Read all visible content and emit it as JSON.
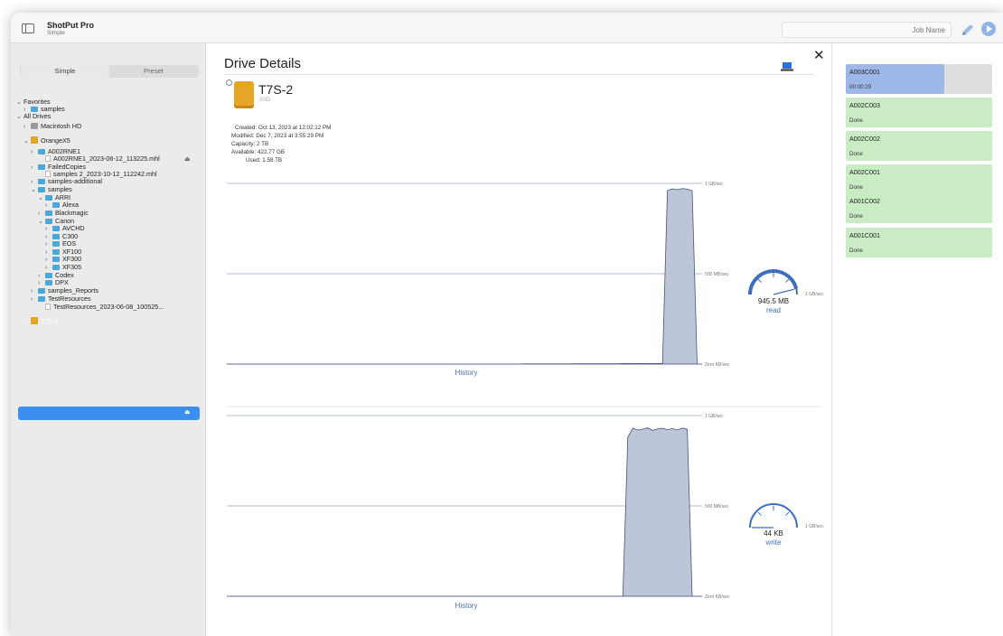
{
  "app": {
    "title": "ShotPut Pro",
    "mode": "Simple",
    "job_name_placeholder": "Job Name"
  },
  "sidebar": {
    "segments": [
      "Simple",
      "Preset"
    ],
    "tree": [
      {
        "label": "Favorites",
        "level": 0,
        "type": "section",
        "chev": "v"
      },
      {
        "label": "samples",
        "level": 1,
        "type": "folder",
        "chev": ">"
      },
      {
        "label": "All Drives",
        "level": 0,
        "type": "section",
        "chev": "v"
      },
      {
        "label": "Macintosh HD",
        "level": 1,
        "type": "hd",
        "chev": ">"
      },
      {
        "label": "OrangeX5",
        "level": 1,
        "type": "drive",
        "chev": "v"
      },
      {
        "label": "A002RNE1",
        "level": 2,
        "type": "folder",
        "chev": ">"
      },
      {
        "label": "A002RNE1_2023-06-12_113225.mhl",
        "level": 3,
        "type": "file",
        "chev": ""
      },
      {
        "label": "FailedCopies",
        "level": 2,
        "type": "folder",
        "chev": ">"
      },
      {
        "label": "samples 2_2023-10-12_112242.mhl",
        "level": 3,
        "type": "file",
        "chev": ""
      },
      {
        "label": "samples-additional",
        "level": 2,
        "type": "folder",
        "chev": ">"
      },
      {
        "label": "samples",
        "level": 2,
        "type": "folder",
        "chev": "v"
      },
      {
        "label": "ARRI",
        "level": 3,
        "type": "folder",
        "chev": "v"
      },
      {
        "label": "Alexa",
        "level": 4,
        "type": "folder",
        "chev": ">"
      },
      {
        "label": "Blackmagic",
        "level": 3,
        "type": "folder",
        "chev": ">"
      },
      {
        "label": "Canon",
        "level": 3,
        "type": "folder",
        "chev": "v"
      },
      {
        "label": "AVCHD",
        "level": 4,
        "type": "folder",
        "chev": ">"
      },
      {
        "label": "C300",
        "level": 4,
        "type": "folder",
        "chev": ">"
      },
      {
        "label": "EOS",
        "level": 4,
        "type": "folder",
        "chev": ">"
      },
      {
        "label": "XF100",
        "level": 4,
        "type": "folder",
        "chev": ">"
      },
      {
        "label": "XF300",
        "level": 4,
        "type": "folder",
        "chev": ">"
      },
      {
        "label": "XF305",
        "level": 4,
        "type": "folder",
        "chev": ">"
      },
      {
        "label": "Codex",
        "level": 3,
        "type": "folder",
        "chev": ">"
      },
      {
        "label": "DPX",
        "level": 3,
        "type": "folder",
        "chev": ">"
      },
      {
        "label": "samples_Reports",
        "level": 2,
        "type": "folder",
        "chev": ">"
      },
      {
        "label": "TestResources",
        "level": 2,
        "type": "folder",
        "chev": ">"
      },
      {
        "label": "TestResources_2023-06-08_100525...",
        "level": 3,
        "type": "file",
        "chev": ""
      },
      {
        "label": "T7S-2",
        "level": 1,
        "type": "drive",
        "chev": ">",
        "selected": true
      }
    ]
  },
  "main": {
    "heading": "Drive Details",
    "drive": {
      "name": "T7S-2",
      "type": "SSD",
      "created": "Created: Oct 13, 2023 at 12:02:12 PM",
      "modified": "Modified: Dec 7, 2023 at 3:55:29 PM",
      "capacity": "Capacity: 2 TB",
      "available": "Available: 422.77 GB",
      "used": "Used: 1.58 TB"
    },
    "read": {
      "value": "945.5 MB",
      "label": "read",
      "history_label": "History",
      "gauge_fraction": 0.92,
      "axis": [
        "1 GB/sec",
        "500 MB/sec",
        "Zero KB/sec"
      ],
      "gauge_max_label": "1 GB/sec"
    },
    "write": {
      "value": "44 KB",
      "label": "write",
      "history_label": "History",
      "gauge_fraction": 0.0,
      "axis": [
        "1 GB/sec",
        "500 MB/sec",
        "Zero KB/sec"
      ],
      "gauge_max_label": "1 GB/sec"
    }
  },
  "chart_data": [
    {
      "type": "area",
      "title": "",
      "ylabel": "",
      "ylim": [
        0,
        1000
      ],
      "y_unit": "MB/sec",
      "series": [
        {
          "values": [
            0,
            0,
            0,
            0,
            0,
            0,
            0,
            0,
            0,
            0,
            0,
            0,
            0,
            0,
            0,
            0,
            0,
            0,
            0,
            0,
            0,
            0,
            0,
            0,
            0,
            0,
            0,
            0,
            0,
            0,
            0,
            0,
            0,
            0,
            0,
            0,
            0,
            0,
            0,
            0,
            0,
            0,
            0,
            0,
            0,
            0,
            0,
            0,
            0,
            0,
            0,
            0,
            0,
            0,
            0,
            0,
            0,
            0,
            0,
            0,
            1,
            1,
            1,
            1,
            1,
            1,
            1,
            1,
            1,
            1,
            2,
            2,
            2,
            2,
            2,
            2,
            2,
            2,
            2,
            2,
            3,
            3,
            3,
            3,
            3,
            3,
            3,
            3,
            3,
            960,
            970,
            965,
            972,
            968,
            960,
            0,
            0
          ]
        }
      ]
    },
    {
      "type": "area",
      "title": "",
      "ylabel": "",
      "ylim": [
        0,
        1000
      ],
      "y_unit": "MB/sec",
      "series": [
        {
          "values": [
            0,
            0,
            0,
            0,
            0,
            0,
            0,
            0,
            0,
            0,
            0,
            0,
            0,
            0,
            0,
            0,
            0,
            0,
            0,
            0,
            0,
            0,
            0,
            0,
            0,
            0,
            0,
            0,
            0,
            0,
            0,
            0,
            0,
            0,
            0,
            0,
            0,
            0,
            0,
            0,
            0,
            0,
            0,
            0,
            0,
            0,
            0,
            0,
            0,
            0,
            0,
            0,
            0,
            0,
            0,
            0,
            0,
            0,
            0,
            0,
            0,
            0,
            0,
            0,
            0,
            0,
            0,
            0,
            0,
            0,
            0,
            0,
            0,
            0,
            0,
            0,
            0,
            0,
            0,
            0,
            0,
            880,
            930,
            920,
            925,
            932,
            918,
            926,
            930,
            922,
            928,
            920,
            931,
            924,
            0,
            0,
            0
          ]
        }
      ]
    }
  ],
  "jobs": [
    {
      "name": "A003C001",
      "status": "00:00:29",
      "state": "active",
      "progress": 0.67
    },
    {
      "name": "A002C003",
      "status": "Done",
      "state": "done"
    },
    {
      "name": "A002C002",
      "status": "Done",
      "state": "done"
    },
    {
      "name": "A002C001",
      "status": "Done",
      "state": "done"
    },
    {
      "name": "A001C002",
      "status": "Done",
      "state": "done"
    },
    {
      "name": "A001C001",
      "status": "Done",
      "state": "done"
    }
  ],
  "colors": {
    "accent": "#3a8ff0",
    "chart_fill": "#bcc6d8",
    "chart_line": "#44547a",
    "gauge": "#3e6fbe",
    "done_bg": "#c9ecc4",
    "active_bg": "#9db8e8"
  }
}
